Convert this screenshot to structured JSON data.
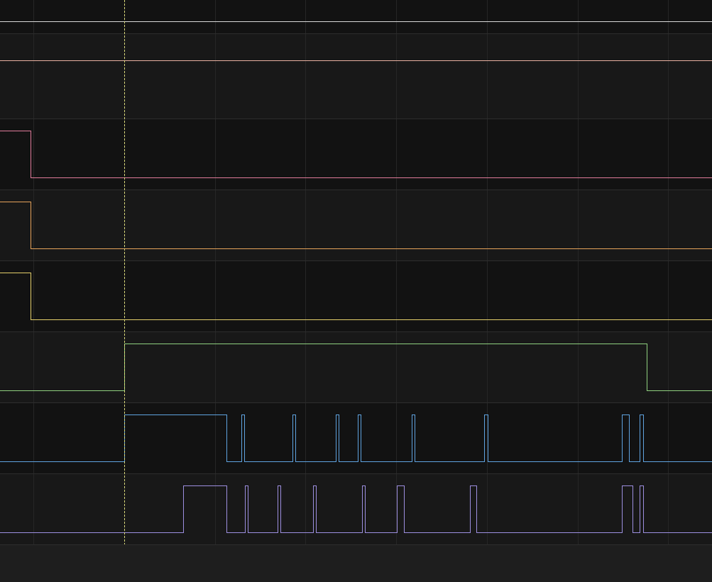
{
  "colors": {
    "background": "#1e1e1e",
    "lane_bg_even": "#121212",
    "lane_bg_odd": "#181818",
    "separator": "#2d2d2d",
    "gridline": "#262626",
    "cursor": "#d9d97a"
  },
  "time_axis": {
    "range": [
      0,
      1003
    ],
    "gridlines": [
      47,
      175,
      303,
      430,
      558,
      686,
      814,
      941
    ],
    "cursor_time": 175
  },
  "lanes": [
    {
      "id": "trace-1",
      "color": "#d8d8d8",
      "kind": "bus",
      "edges": [],
      "initial": 1
    },
    {
      "id": "trace-2",
      "color": "#e8b0a0",
      "kind": "bus",
      "edges": [],
      "initial": 1
    },
    {
      "id": "trace-3",
      "color": "#e07b9a",
      "kind": "digital",
      "initial": 1,
      "edges": [
        43
      ]
    },
    {
      "id": "trace-4",
      "color": "#e6a35a",
      "kind": "digital",
      "initial": 1,
      "edges": [
        43
      ]
    },
    {
      "id": "trace-5",
      "color": "#e4cf6a",
      "kind": "digital",
      "initial": 1,
      "edges": [
        43
      ]
    },
    {
      "id": "trace-6",
      "color": "#8fd07f",
      "kind": "digital",
      "initial": 0,
      "edges": [
        175,
        911
      ]
    },
    {
      "id": "trace-7",
      "color": "#5fa3e0",
      "kind": "digital",
      "initial": 0,
      "edges": [
        175,
        319,
        340,
        344,
        412,
        416,
        473,
        477,
        504,
        508,
        580,
        584,
        682,
        687,
        876,
        886,
        901,
        906
      ]
    },
    {
      "id": "trace-8",
      "color": "#9d8fe0",
      "kind": "digital",
      "initial": 0,
      "edges": [
        258,
        319,
        345,
        349,
        391,
        395,
        441,
        445,
        510,
        514,
        559,
        569,
        662,
        671,
        876,
        891,
        901,
        906
      ]
    }
  ]
}
